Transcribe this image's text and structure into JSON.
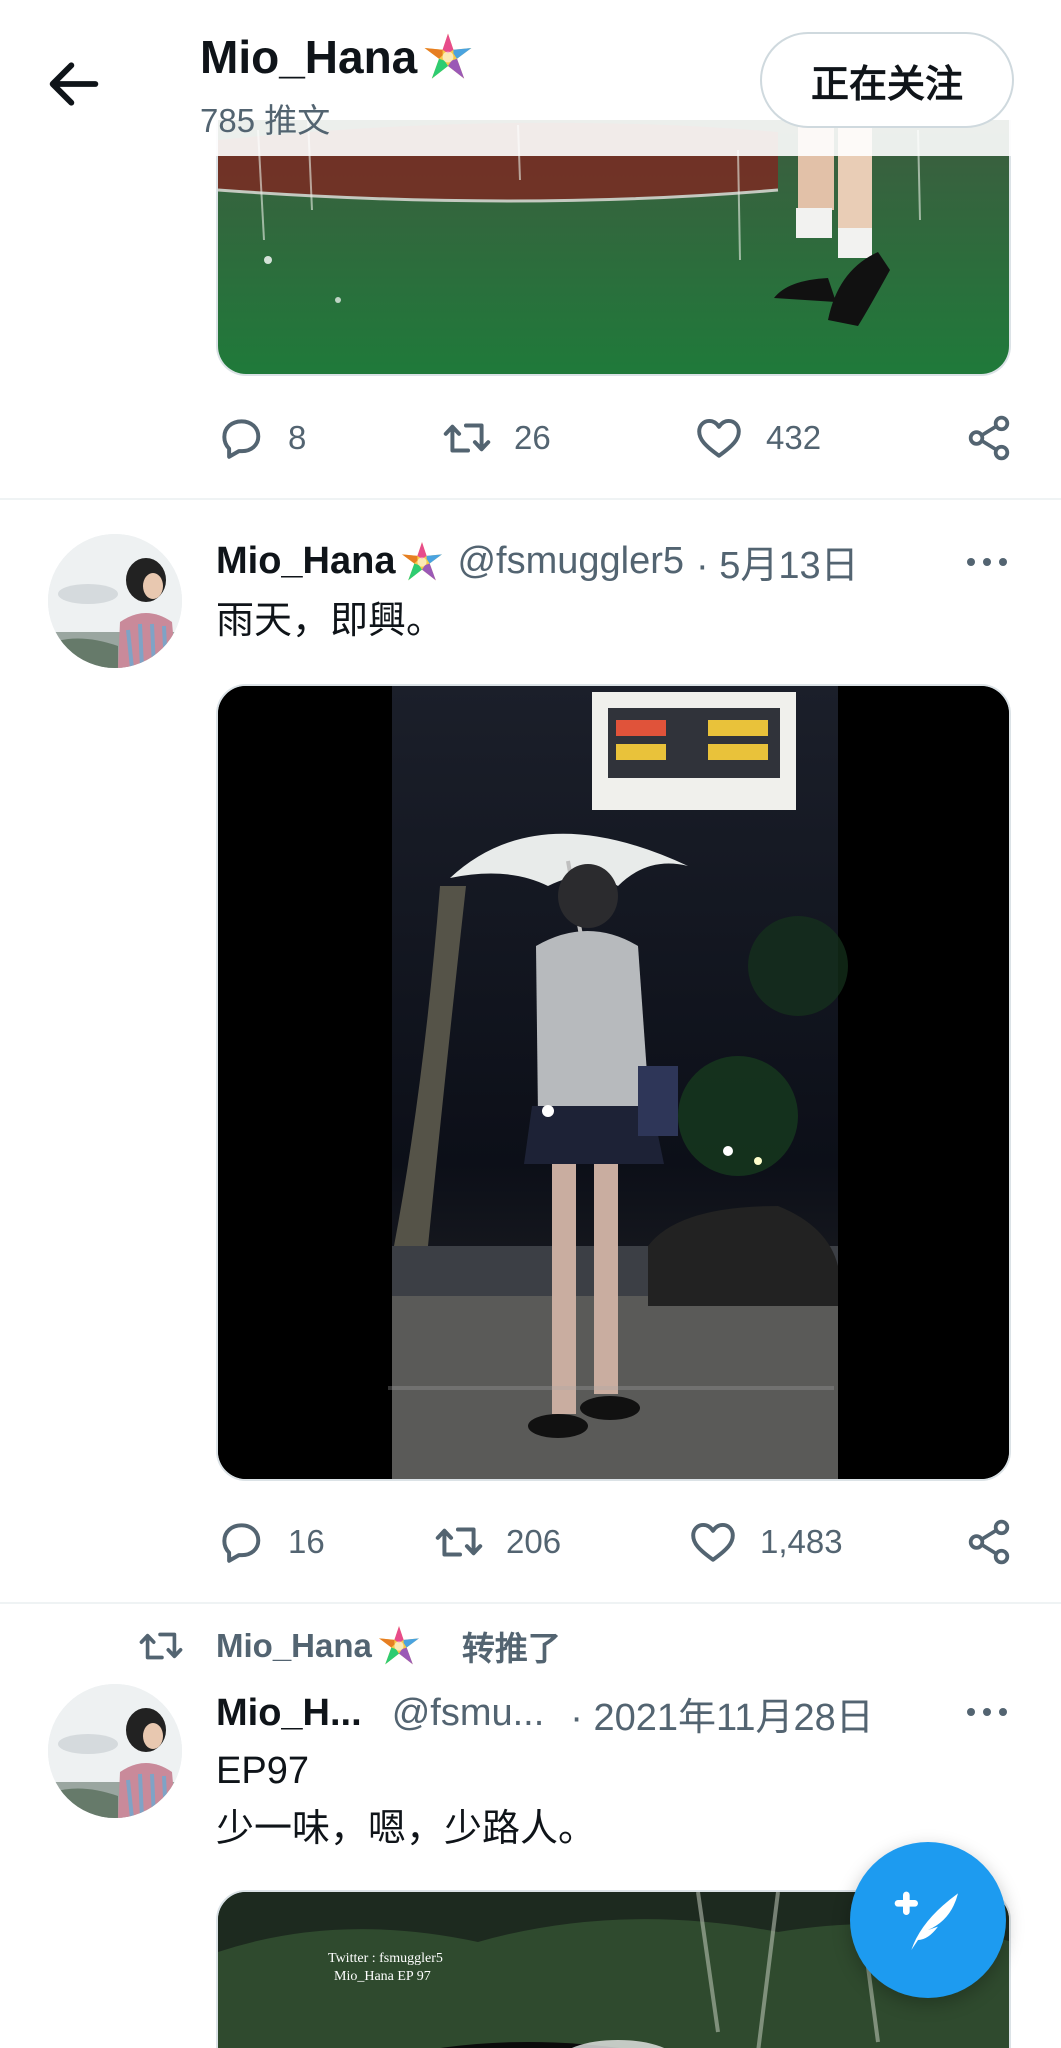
{
  "header": {
    "name": "Mio_Hana",
    "tweet_count": "785 推文",
    "follow_label": "正在关注"
  },
  "tweets": [
    {
      "reply_count": "8",
      "retweet_count": "26",
      "like_count": "432"
    },
    {
      "name": "Mio_Hana",
      "handle": "@fsmuggler5",
      "date": "· 5月13日",
      "text": "雨天，即興。",
      "reply_count": "16",
      "retweet_count": "206",
      "like_count": "1,483"
    },
    {
      "retweeted_by": "Mio_Hana",
      "retweet_label": "转推了",
      "name": "Mio_H...",
      "handle": "@fsmu...",
      "date": "· 2021年11月28日",
      "text_line1": "EP97",
      "text_line2": "少一味，嗯，少路人。",
      "image_watermark_line1": "Twitter : fsmuggler5",
      "image_watermark_line2": "Mio_Hana EP 97"
    }
  ],
  "icons": {
    "back": "arrow-left-icon",
    "emoji": "pinata-emoji-icon",
    "reply": "reply-icon",
    "retweet": "retweet-icon",
    "like": "heart-icon",
    "share": "share-icon",
    "more": "more-dots-icon",
    "compose": "compose-feather-icon"
  },
  "colors": {
    "accent": "#1d9bf0",
    "secondary_text": "#536471",
    "primary_text": "#0f1419",
    "divider": "#eff3f4"
  }
}
